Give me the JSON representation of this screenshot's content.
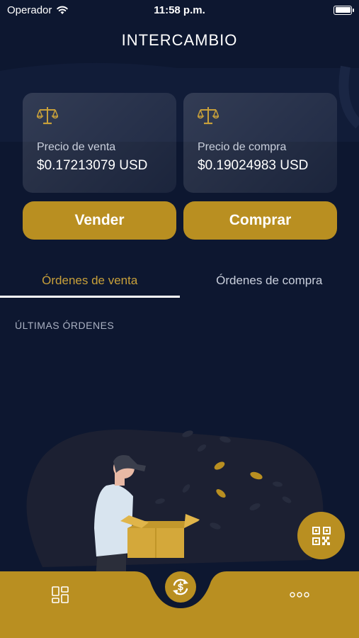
{
  "status_bar": {
    "carrier": "Operador",
    "time": "11:58 p.m.",
    "wifi_icon": "wifi-icon",
    "battery_icon": "battery-icon"
  },
  "header": {
    "title": "INTERCAMBIO"
  },
  "cards": {
    "sell": {
      "icon": "scale-icon",
      "label": "Precio de venta",
      "value": "$0.17213079 USD"
    },
    "buy": {
      "icon": "scale-icon",
      "label": "Precio de compra",
      "value": "$0.19024983 USD"
    }
  },
  "actions": {
    "sell_label": "Vender",
    "buy_label": "Comprar"
  },
  "tabs": [
    {
      "label": "Órdenes de venta",
      "active": true
    },
    {
      "label": "Órdenes de compra",
      "active": false
    }
  ],
  "orders": {
    "heading": "ÚLTIMAS ÓRDENES",
    "illustration": "empty-orders-illustration"
  },
  "fab": {
    "icon": "qr-code-icon"
  },
  "bottom_nav": {
    "items": [
      "dashboard-icon",
      "exchange-icon",
      "more-icon"
    ]
  },
  "colors": {
    "background": "#0d1730",
    "accent": "#b98f21",
    "accent_text": "#c8a03a",
    "card": "#1e2841"
  }
}
